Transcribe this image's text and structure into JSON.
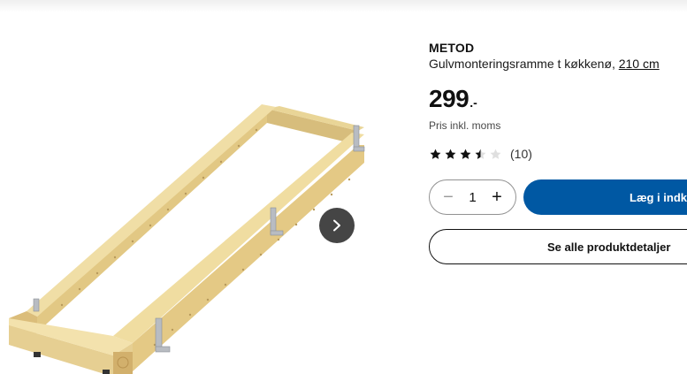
{
  "product": {
    "brand": "METOD",
    "description": "Gulvmonteringsramme t køkkenø,",
    "size_link": "210 cm",
    "price_integer": "299",
    "price_suffix": ".-",
    "vat_note": "Pris inkl. moms",
    "rating": {
      "value": 3.5,
      "max": 5,
      "review_count": "(10)"
    }
  },
  "quantity": {
    "minus": "−",
    "value": "1",
    "plus": "+"
  },
  "actions": {
    "add_to_cart": "Læg i indkøbskurv",
    "all_details": "Se alle produktdetaljer"
  },
  "gallery": {
    "next_icon": "chevron-right-icon"
  },
  "colors": {
    "accent": "#0058a3",
    "star_filled": "#111111",
    "star_empty": "#dfdfdf",
    "nav_button": "#454545"
  }
}
